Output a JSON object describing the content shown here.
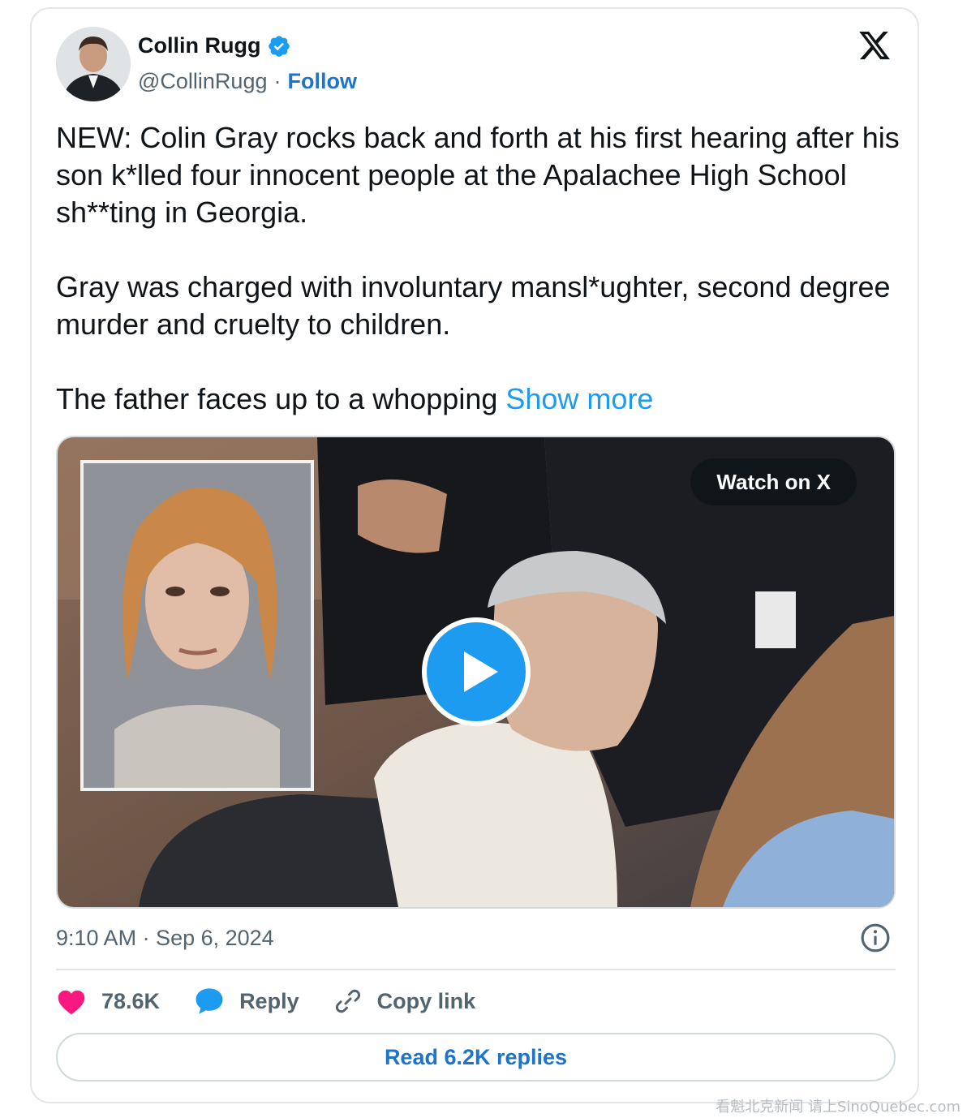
{
  "author": {
    "display_name": "Collin Rugg",
    "handle": "@CollinRugg",
    "separator": "·",
    "follow_label": "Follow",
    "verified_icon": "verified-badge-icon"
  },
  "tweet": {
    "paragraph_1": "NEW: Colin Gray rocks back and forth at his first hearing after his son k*lled four innocent people at the Apalachee High School sh**ting in Georgia.",
    "paragraph_2": "Gray was charged with involuntary mansl*ughter, second degree murder and cruelty to children.",
    "paragraph_3": "The father faces up to a whopping ",
    "show_more_label": "Show more"
  },
  "media": {
    "watch_label": "Watch on X",
    "play_icon": "play-icon"
  },
  "meta": {
    "timestamp": "9:10 AM · Sep 6, 2024"
  },
  "actions": {
    "like_count": "78.6K",
    "reply_label": "Reply",
    "copy_link_label": "Copy link"
  },
  "read_replies_label": "Read 6.2K replies",
  "watermark": "看魁北克新闻 请上SinoQuebec.com",
  "colors": {
    "accent_blue": "#1d9bf0",
    "link_blue": "#1d74c9",
    "like_pink": "#f91880",
    "muted_text": "#536471"
  }
}
